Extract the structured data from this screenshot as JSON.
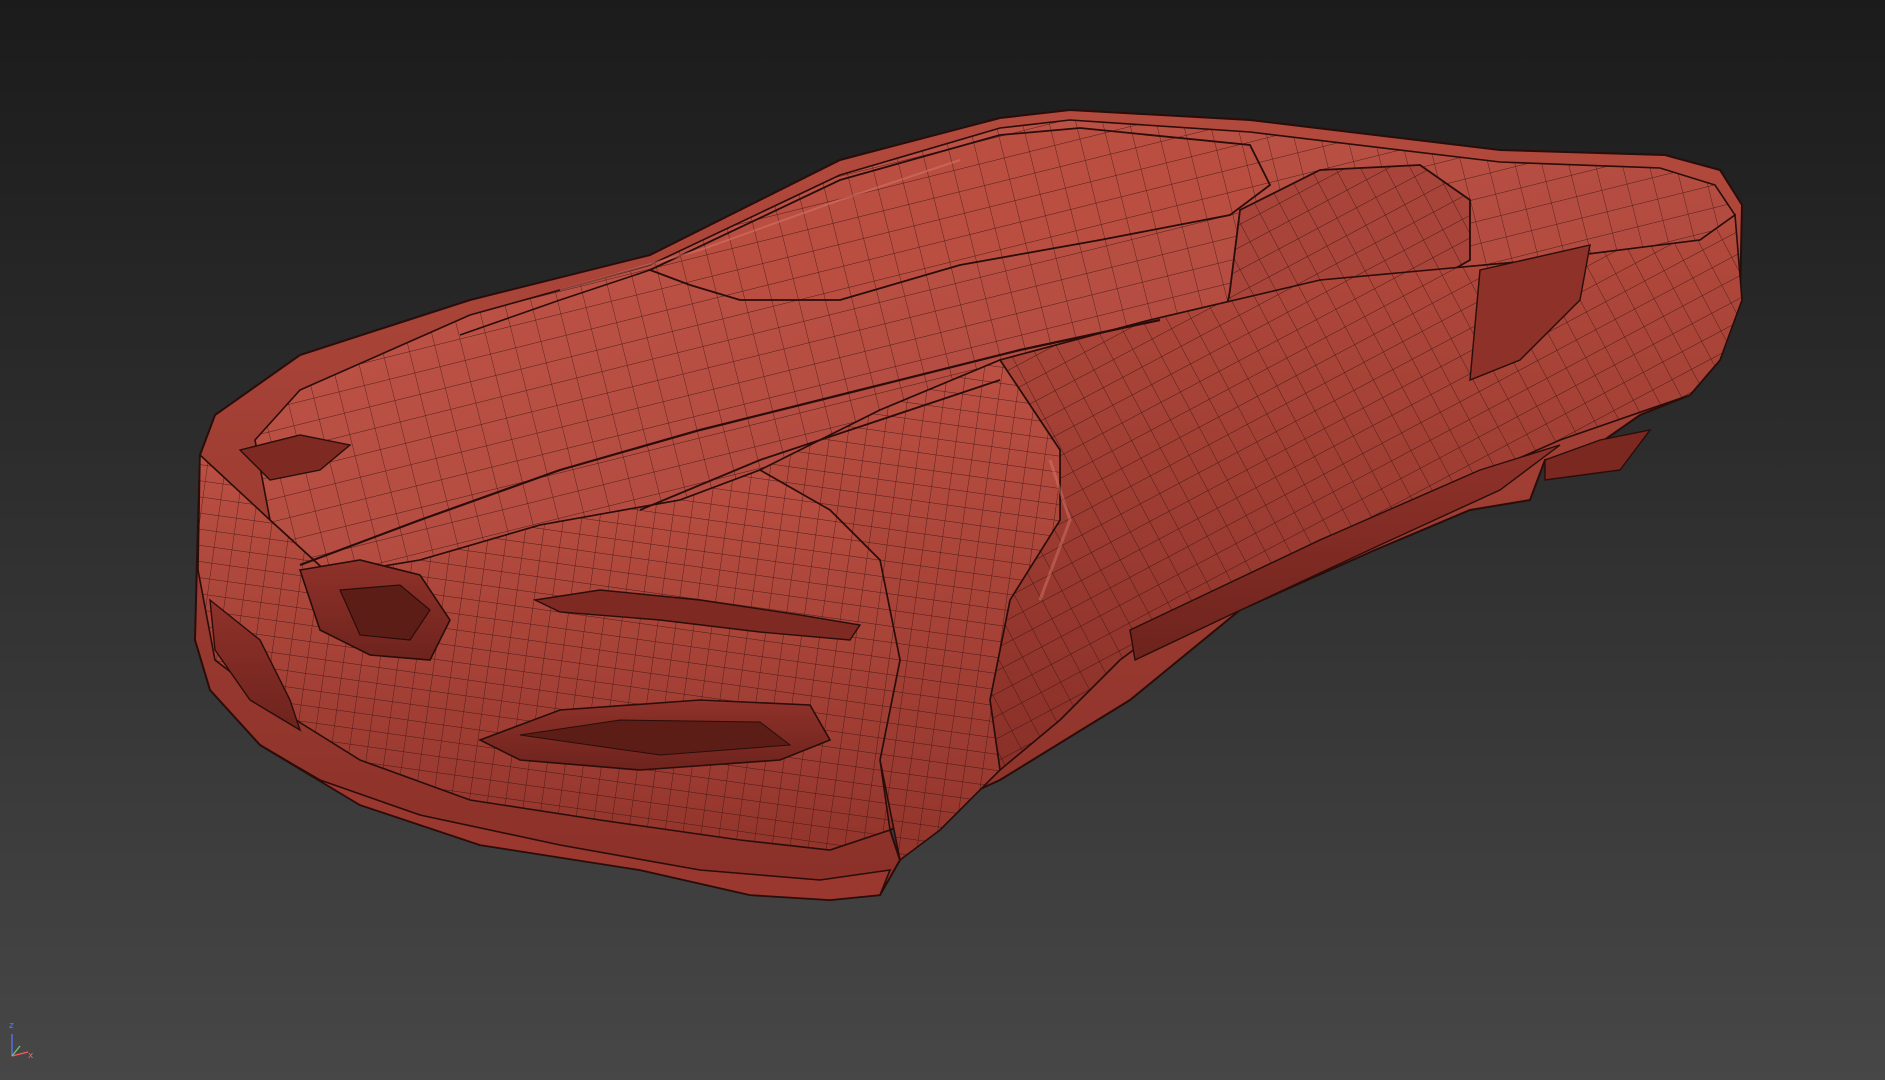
{
  "viewport": {
    "background_top": "#1b1b1b",
    "background_bottom": "#474747"
  },
  "model": {
    "shading": "edged-faces",
    "base_color": "#b4463a",
    "highlight_color": "#c85a4c",
    "shadow_color": "#7a2a22",
    "wire_color": "#2a0d0a"
  },
  "axis_gizmo": {
    "z_label": "z",
    "x_label": "x",
    "z_color": "#5a78ff",
    "x_color": "#ff5a5a",
    "y_color": "#6ad06a"
  }
}
